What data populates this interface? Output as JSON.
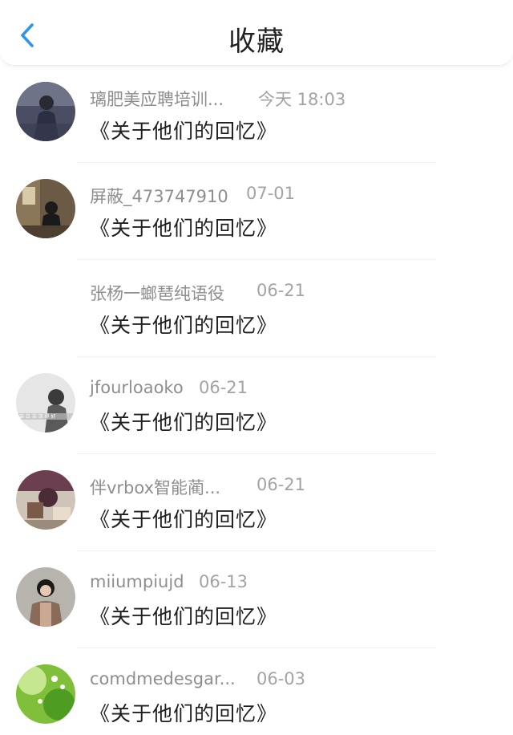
{
  "header": {
    "title": "收藏",
    "back_icon": "chevron-left-icon",
    "accent_color": "#2f95e8"
  },
  "favorites": [
    {
      "name": "璃肥美应聘培训...",
      "date": "今天 18:03",
      "content": "《关于他们的回忆》",
      "avatar": "photo-avatar"
    },
    {
      "name": "屏蔽_473747910",
      "date": "07-01",
      "content": "《关于他们的回忆》",
      "avatar": "photo-avatar"
    },
    {
      "name": "张杨一螂琶纯语役",
      "date": "06-21",
      "content": "《关于他们的回忆》",
      "avatar": "none"
    },
    {
      "name": "jfourloaoko",
      "date": "06-21",
      "content": "《关于他们的回忆》",
      "avatar": "photo-avatar"
    },
    {
      "name": "伴vrbox智能蔺...",
      "date": "06-21",
      "content": "《关于他们的回忆》",
      "avatar": "photo-avatar"
    },
    {
      "name": "miiumpiujd",
      "date": "06-13",
      "content": "《关于他们的回忆》",
      "avatar": "photo-avatar"
    },
    {
      "name": "comdmedesgar...",
      "date": "06-03",
      "content": "《关于他们的回忆》",
      "avatar": "photo-avatar"
    }
  ]
}
